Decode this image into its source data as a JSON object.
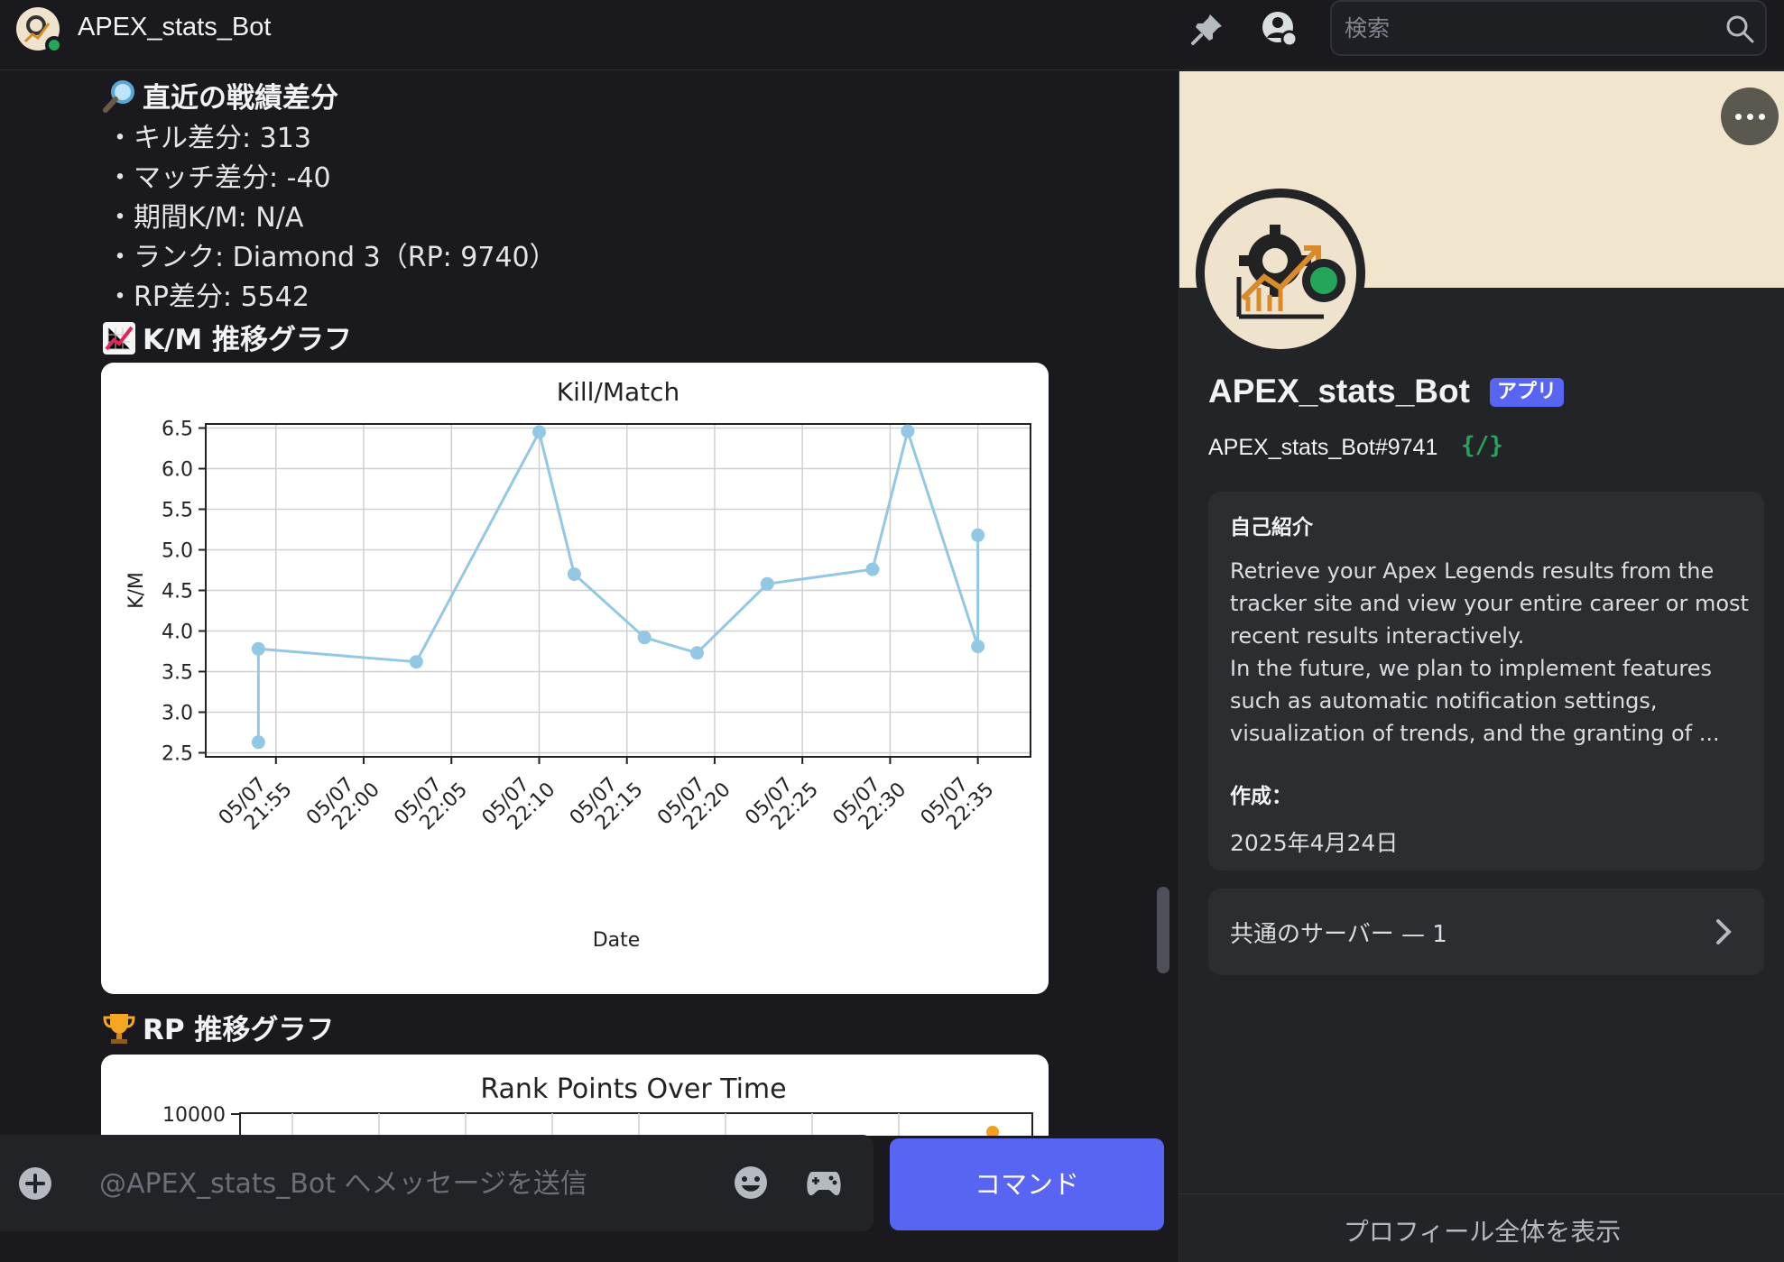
{
  "header": {
    "title": "APEX_stats_Bot",
    "search_placeholder": "検索"
  },
  "message": {
    "stats_heading": "直近の戦績差分",
    "lines": [
      "・キル差分: 313",
      "・マッチ差分: -40",
      "・期間K/M: N/A",
      "・ランク: Diamond 3（RP: 9740）",
      "・RP差分: 5542"
    ],
    "km_heading": "K/M 推移グラフ",
    "rp_heading": "RP 推移グラフ"
  },
  "chart_data": [
    {
      "type": "line",
      "title": "Kill/Match",
      "xlabel": "Date",
      "ylabel": "K/M",
      "ylim": [
        2.45,
        6.55
      ],
      "yticks": [
        2.5,
        3.0,
        3.5,
        4.0,
        4.5,
        5.0,
        5.5,
        6.0,
        6.5
      ],
      "ytick_labels": [
        "2.5",
        "3.0",
        "3.5",
        "4.0",
        "4.5",
        "5.0",
        "5.5",
        "6.0",
        "6.5"
      ],
      "xrange": [
        "21:51",
        "22:38"
      ],
      "xticks": [
        "21:55",
        "22:00",
        "22:05",
        "22:10",
        "22:15",
        "22:20",
        "22:25",
        "22:30",
        "22:35"
      ],
      "xtick_labels": [
        "05/07\n21:55",
        "05/07\n22:00",
        "05/07\n22:05",
        "05/07\n22:10",
        "05/07\n22:15",
        "05/07\n22:20",
        "05/07\n22:25",
        "05/07\n22:30",
        "05/07\n22:35"
      ],
      "grid": true,
      "color": "#93c8e4",
      "series": [
        {
          "x": [
            "21:54",
            "21:54",
            "22:03",
            "22:10",
            "22:12",
            "22:16",
            "22:19",
            "22:23",
            "22:29",
            "22:31",
            "22:35",
            "22:35"
          ],
          "y": [
            2.63,
            3.78,
            3.62,
            6.45,
            4.7,
            3.92,
            3.73,
            4.58,
            4.76,
            6.46,
            3.81,
            5.18
          ]
        }
      ]
    },
    {
      "type": "line",
      "title": "Rank Points Over Time",
      "ytick_labels": [
        "10000"
      ],
      "color": "#f0a020"
    }
  ],
  "profile": {
    "name": "APEX_stats_Bot",
    "badge": "アプリ",
    "tag": "APEX_stats_Bot#9741",
    "about_heading": "自己紹介",
    "about_text": "Retrieve your Apex Legends results from the tracker site and view your entire career or most recent results interactively.\nIn the future, we plan to implement features such as automatic notification settings, visualization of trends, and the granting of ...",
    "created_heading": "作成：",
    "created_date": "2025年4月24日",
    "mutual_servers": "共通のサーバー — 1",
    "view_full": "プロフィール全体を表示"
  },
  "composer": {
    "placeholder": "@APEX_stats_Bot へメッセージを送信",
    "command_label": "コマンド"
  },
  "colors": {
    "accent": "#5865f2",
    "online": "#23a55a",
    "banner": "#f1e6cd"
  }
}
